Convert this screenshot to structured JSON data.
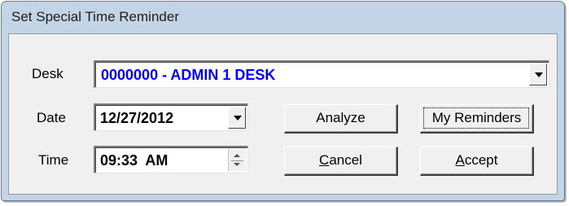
{
  "window": {
    "title": "Set Special Time Reminder"
  },
  "desk": {
    "label": "Desk",
    "value": "0000000 - ADMIN 1 DESK",
    "value_color": "#0000ff"
  },
  "date": {
    "label": "Date",
    "value": "12/27/2012"
  },
  "time": {
    "label": "Time",
    "value": "09:33  AM"
  },
  "buttons": {
    "analyze": "Analyze",
    "my_reminders": "My Reminders",
    "cancel_prefix": "C",
    "cancel_rest": "ancel",
    "accept_prefix": "A",
    "accept_rest": "ccept"
  },
  "icons": {
    "dropdown": "chevron-down-icon",
    "spinner": "spin-up-down-icon"
  }
}
